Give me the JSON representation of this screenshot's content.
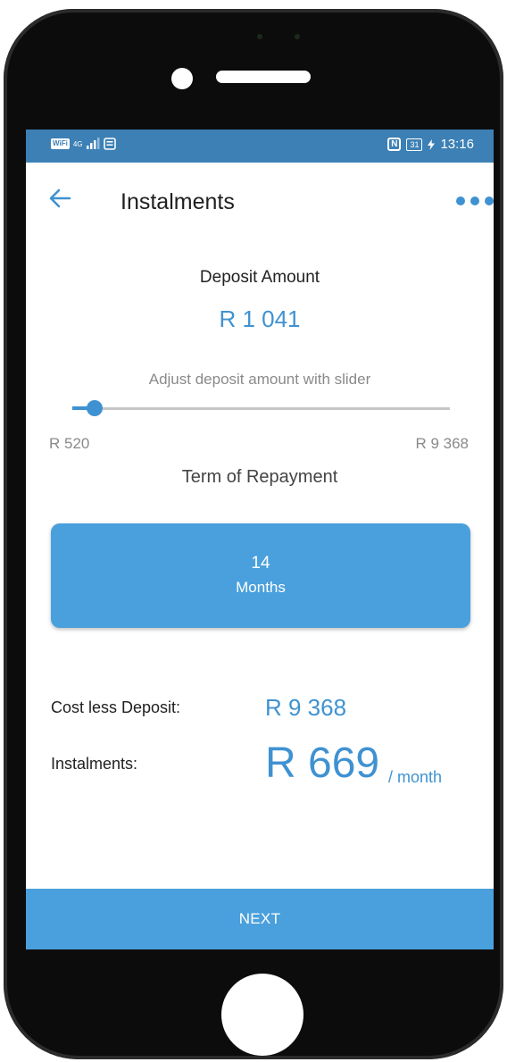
{
  "status_bar": {
    "wifi_badge": "WiFi",
    "network": "4G",
    "nfc": "N",
    "battery": "31",
    "time": "13:16"
  },
  "header": {
    "back_icon": "arrow-left-icon",
    "title": "Instalments",
    "menu_icon": "more-dots-icon"
  },
  "deposit": {
    "label": "Deposit Amount",
    "value": "R 1 041",
    "slider_hint": "Adjust deposit amount with slider",
    "slider_min": "R 520",
    "slider_max": "R 9 368",
    "slider_position": 0.06
  },
  "term": {
    "label": "Term of Repayment",
    "number": "14",
    "unit": "Months"
  },
  "summary": {
    "cost_label": "Cost less Deposit:",
    "cost_value": "R 9 368",
    "instalments_label": "Instalments:",
    "instalments_value": "R 669",
    "instalments_unit": "/ month"
  },
  "footer": {
    "next_label": "NEXT"
  },
  "colors": {
    "accent": "#3f92d1",
    "status_bar": "#3c80b5",
    "button": "#4aa0dc"
  }
}
